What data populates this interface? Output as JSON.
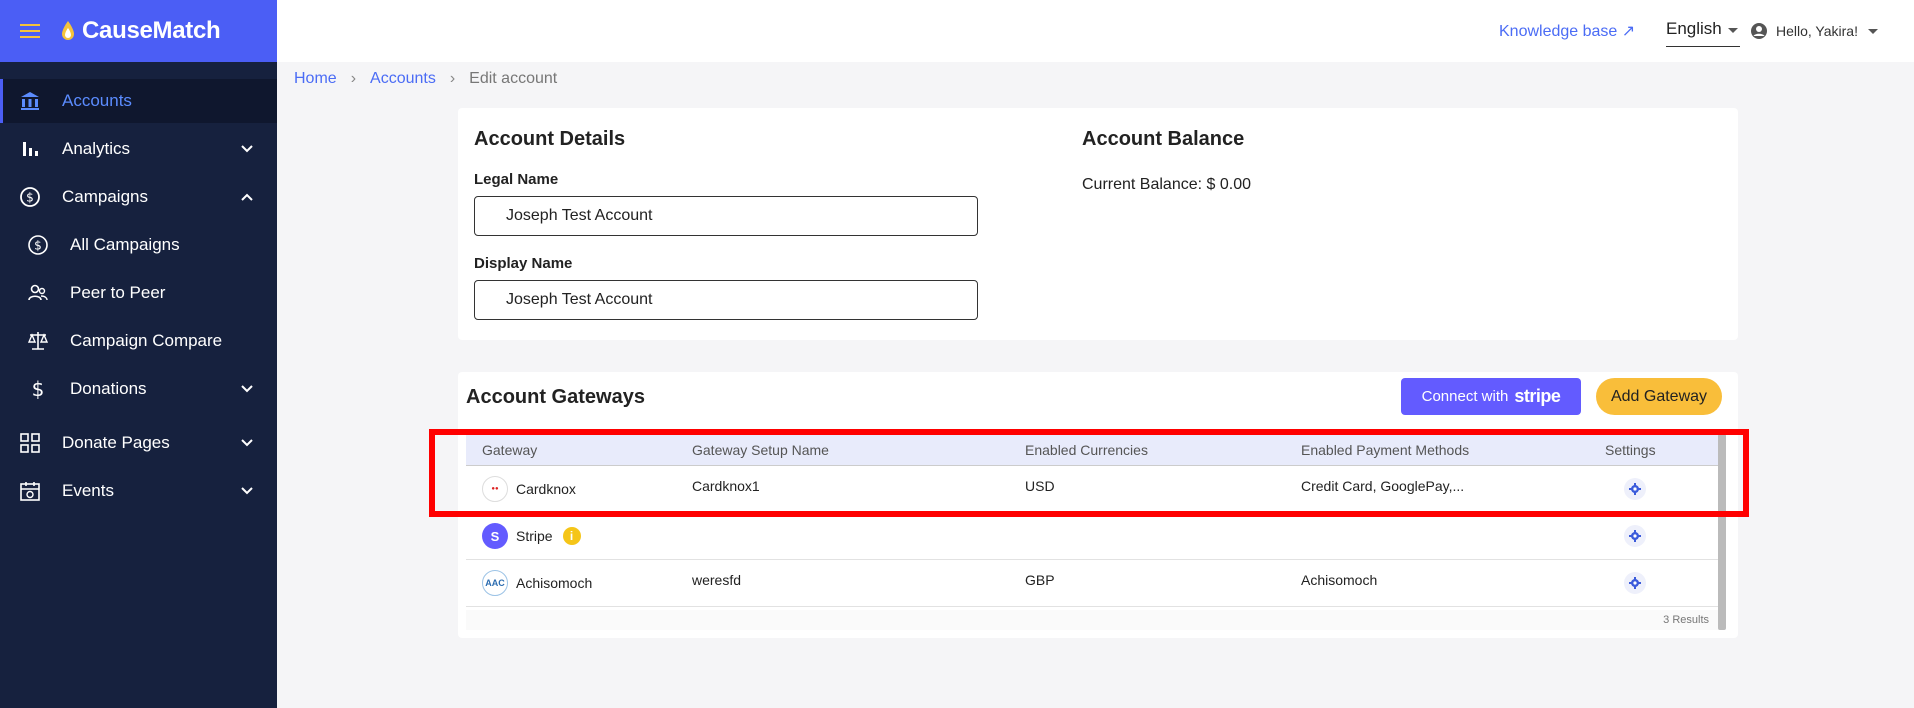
{
  "brand": {
    "name": "CauseMatch",
    "accent": "#4b5ef5"
  },
  "sidebar": {
    "items": [
      {
        "label": "Accounts",
        "icon": "bank-icon",
        "active": true
      },
      {
        "label": "Analytics",
        "icon": "bar-chart-icon",
        "chevron": "down"
      },
      {
        "label": "Campaigns",
        "icon": "dollar-circle-icon",
        "chevron": "up"
      },
      {
        "label": "All Campaigns",
        "icon": "dollar-circle-icon",
        "sub": true
      },
      {
        "label": "Peer to Peer",
        "icon": "people-icon",
        "sub": true
      },
      {
        "label": "Campaign Compare",
        "icon": "scale-icon",
        "sub": true
      },
      {
        "label": "Donations",
        "icon": "dollar-icon",
        "chevron": "down",
        "sub": true
      },
      {
        "label": "Donate Pages",
        "icon": "grid-icon",
        "chevron": "down"
      },
      {
        "label": "Events",
        "icon": "calendar-icon",
        "chevron": "down"
      }
    ]
  },
  "header": {
    "knowledge_base": "Knowledge base ↗",
    "language": "English",
    "greeting": "Hello, Yakira!"
  },
  "breadcrumb": {
    "home": "Home",
    "accounts": "Accounts",
    "current": "Edit account"
  },
  "details": {
    "title": "Account Details",
    "legal_name_label": "Legal Name",
    "legal_name_value": "Joseph Test Account",
    "display_name_label": "Display Name",
    "display_name_value": "Joseph Test Account"
  },
  "balance": {
    "title": "Account Balance",
    "current": "Current Balance: $ 0.00"
  },
  "gateways": {
    "title": "Account Gateways",
    "connect_label": "Connect with",
    "stripe_logo": "stripe",
    "add_label": "Add Gateway",
    "columns": [
      "Gateway",
      "Gateway Setup Name",
      "Enabled Currencies",
      "Enabled Payment Methods",
      "Settings"
    ],
    "rows": [
      {
        "gateway": "Cardknox",
        "setup": "Cardknox1",
        "currencies": "USD",
        "methods": "Credit Card, GooglePay,...",
        "logo": "cardknox-logo"
      },
      {
        "gateway": "Stripe",
        "setup": "",
        "currencies": "",
        "methods": "",
        "logo": "stripe-logo"
      },
      {
        "gateway": "Achisomoch",
        "setup": "weresfd",
        "currencies": "GBP",
        "methods": "Achisomoch",
        "logo": "AAC"
      }
    ],
    "results": "3 Results"
  }
}
